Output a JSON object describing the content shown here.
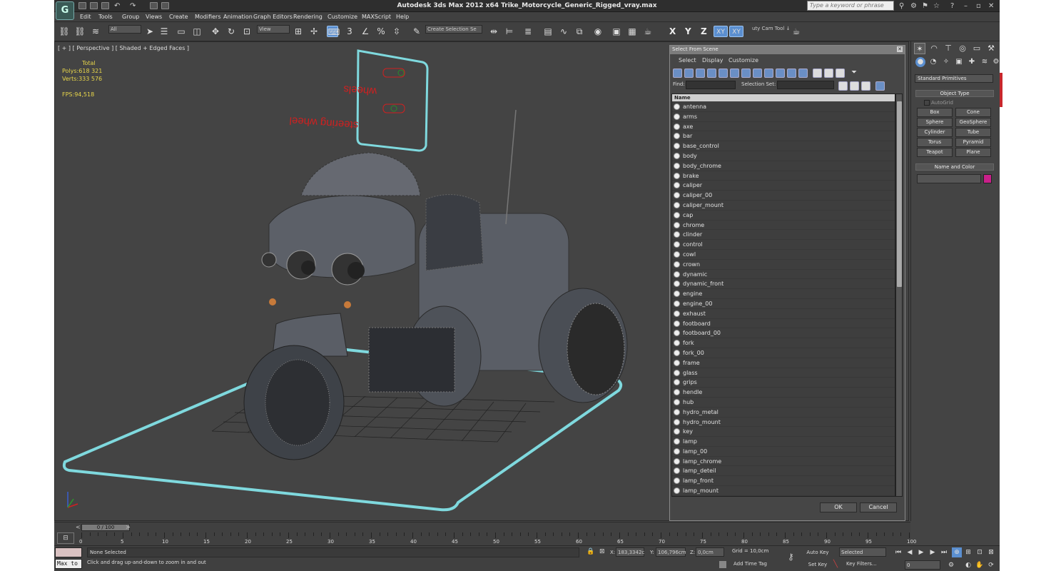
{
  "window": {
    "title": "Autodesk 3ds Max  2012 x64     Trike_Motorcycle_Generic_Rigged_vray.max",
    "search_placeholder": "Type a keyword or phrase",
    "logo_icon": "3ds-max-logo"
  },
  "menu": [
    "Edit",
    "Tools",
    "Group",
    "Views",
    "Create",
    "Modifiers",
    "Animation",
    "Graph Editors",
    "Rendering",
    "Customize",
    "MAXScript",
    "Help"
  ],
  "toolbar": {
    "filter": "All",
    "ref_coord": "View",
    "snap_label": "3",
    "selection_set": "Create Selection Se",
    "axis_x": "X",
    "axis_y": "Y",
    "axis_z": "Z",
    "axis_xy": "XY",
    "axis_xy2": "XY",
    "tool_label": "uty Cam Tool ↓",
    "accent": "#5b8fd0"
  },
  "viewport": {
    "label": "[ + ] [ Perspective ] [ Shaded + Edged Faces ]",
    "stats_header": "Total",
    "polys_label": "Polys:",
    "polys_value": "618 321",
    "verts_label": "Verts:",
    "verts_value": "333 576",
    "fps_label": "FPS:",
    "fps_value": "94,518",
    "sign_top": "wheels",
    "sign_bottom": "steering wheel"
  },
  "select_from_scene": {
    "title": "Select From Scene",
    "tabs": [
      "Select",
      "Display",
      "Customize"
    ],
    "find_label": "Find:",
    "selection_set_label": "Selection Set:",
    "column_name": "Name",
    "items": [
      "antenna",
      "arms",
      "axe",
      "bar",
      "base_control",
      "body",
      "body_chrome",
      "brake",
      "caliper",
      "caliper_00",
      "caliper_mount",
      "cap",
      "chrome",
      "clinder",
      "control",
      "cowl",
      "crown",
      "dynamic",
      "dynamic_front",
      "engine",
      "engine_00",
      "exhaust",
      "footboard",
      "footboard_00",
      "fork",
      "fork_00",
      "frame",
      "glass",
      "grips",
      "hendle",
      "hub",
      "hydro_metal",
      "hydro_mount",
      "key",
      "lamp",
      "lamp_00",
      "lamp_chrome",
      "lamp_deteil",
      "lamp_front",
      "lamp_mount"
    ],
    "ok": "OK",
    "cancel": "Cancel"
  },
  "command_panel": {
    "category": "Standard Primitives",
    "object_type": "Object Type",
    "autogrid": "AutoGrid",
    "primitives": [
      "Box",
      "Cone",
      "Sphere",
      "GeoSphere",
      "Cylinder",
      "Tube",
      "Torus",
      "Pyramid",
      "Teapot",
      "Plane"
    ],
    "name_and_color": "Name and Color",
    "color": "#c9208a"
  },
  "timeline": {
    "slider": "0 / 100",
    "ticks": [
      "0",
      "5",
      "10",
      "15",
      "20",
      "25",
      "30",
      "35",
      "40",
      "45",
      "50",
      "55",
      "60",
      "65",
      "70",
      "75",
      "80",
      "85",
      "90",
      "95",
      "100"
    ]
  },
  "status": {
    "maxscript": "Max to",
    "selection": "None Selected",
    "prompt": "Click and drag up-and-down to zoom in and out",
    "x_label": "X:",
    "x_value": "183,3342c",
    "y_label": "Y:",
    "y_value": "106,796cm",
    "z_label": "Z:",
    "z_value": "0,0cm",
    "grid": "Grid = 10,0cm",
    "add_time_tag": "Add Time Tag",
    "auto_key": "Auto Key",
    "set_key": "Set Key",
    "selected": "Selected",
    "key_filters": "Key Filters...",
    "frame": "0"
  }
}
